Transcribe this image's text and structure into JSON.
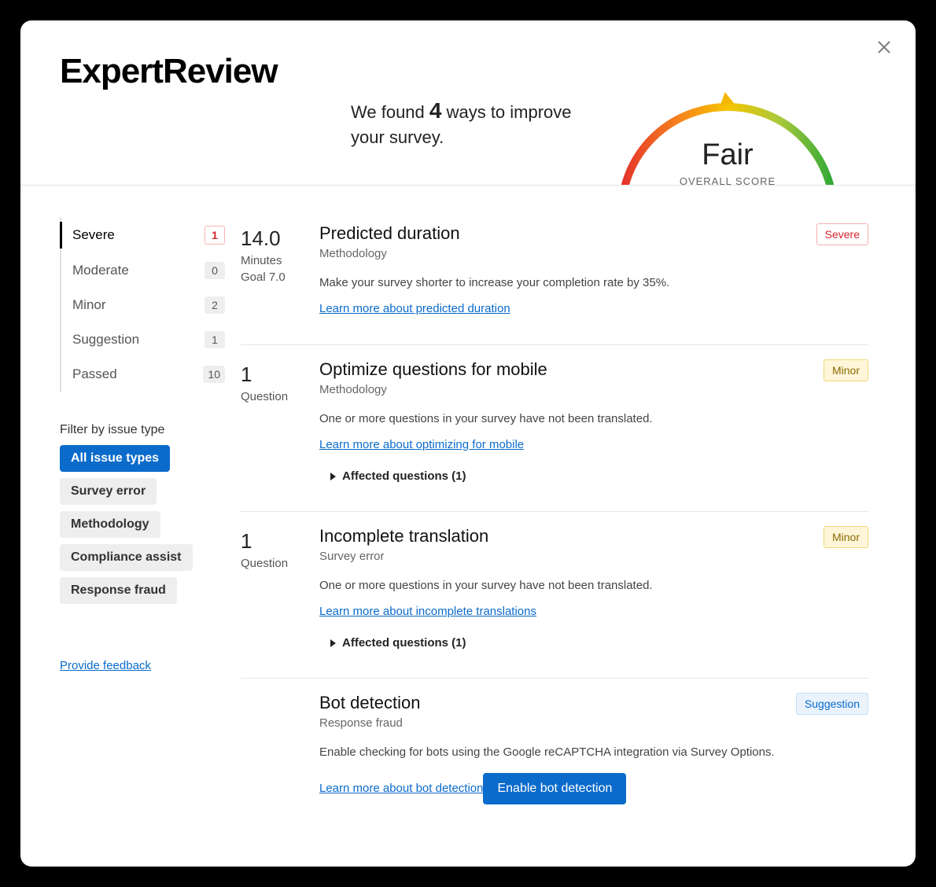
{
  "brand": "ExpertReview",
  "summary": {
    "prefix": "We found ",
    "count": "4",
    "suffix": " ways to improve your survey."
  },
  "gauge": {
    "score_label": "Fair",
    "sub_label": "OVERALL SCORE"
  },
  "severity": [
    {
      "label": "Severe",
      "count": "1",
      "active": true,
      "variant": "red"
    },
    {
      "label": "Moderate",
      "count": "0",
      "active": false,
      "variant": ""
    },
    {
      "label": "Minor",
      "count": "2",
      "active": false,
      "variant": ""
    },
    {
      "label": "Suggestion",
      "count": "1",
      "active": false,
      "variant": ""
    },
    {
      "label": "Passed",
      "count": "10",
      "active": false,
      "variant": ""
    }
  ],
  "filter_label": "Filter by issue type",
  "filters": [
    {
      "label": "All issue types",
      "active": true
    },
    {
      "label": "Survey error",
      "active": false
    },
    {
      "label": "Methodology",
      "active": false
    },
    {
      "label": "Compliance assist",
      "active": false
    },
    {
      "label": "Response fraud",
      "active": false
    }
  ],
  "feedback_link": "Provide feedback",
  "issues": [
    {
      "metric_value": "14.0",
      "metric_unit": "Minutes",
      "metric_goal": "Goal 7.0",
      "title": "Predicted duration",
      "category": "Methodology",
      "badge": "Severe",
      "badge_class": "severe",
      "description": "Make your survey shorter to increase your completion rate by 35%.",
      "link": "Learn more about predicted duration",
      "affected": "",
      "action": ""
    },
    {
      "metric_value": "1",
      "metric_unit": "Question",
      "metric_goal": "",
      "title": "Optimize questions for mobile",
      "category": "Methodology",
      "badge": "Minor",
      "badge_class": "minor",
      "description": "One or more questions in your survey have not been translated.",
      "link": "Learn more about optimizing for mobile",
      "affected": "Affected questions (1)",
      "action": ""
    },
    {
      "metric_value": "1",
      "metric_unit": "Question",
      "metric_goal": "",
      "title": "Incomplete translation",
      "category": "Survey error",
      "badge": "Minor",
      "badge_class": "minor",
      "description": "One or more questions in your survey have not been translated.",
      "link": "Learn more about incomplete translations",
      "affected": "Affected questions (1)",
      "action": ""
    },
    {
      "metric_value": "",
      "metric_unit": "",
      "metric_goal": "",
      "title": "Bot detection",
      "category": "Response fraud",
      "badge": "Suggestion",
      "badge_class": "suggestion",
      "description": "Enable checking for bots using the Google reCAPTCHA integration via Survey Options.",
      "link": "Learn more about bot detection",
      "affected": "",
      "action": "Enable bot detection"
    }
  ]
}
